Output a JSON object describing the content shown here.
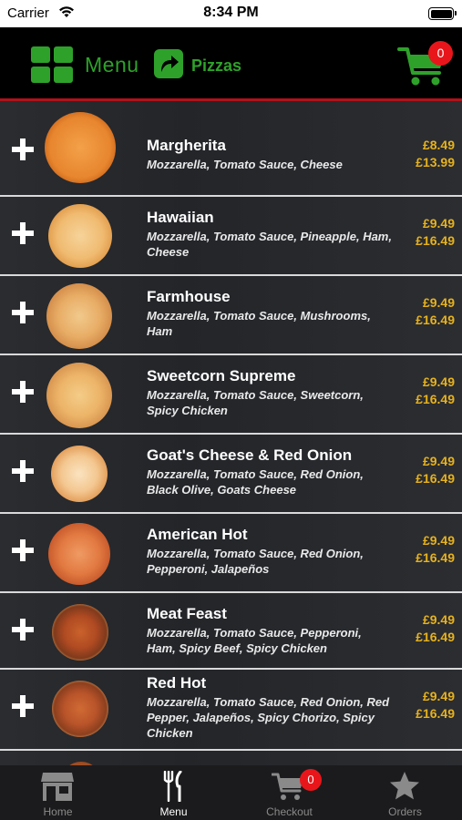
{
  "status_bar": {
    "carrier": "Carrier",
    "time": "8:34 PM"
  },
  "header": {
    "menu_label": "Menu",
    "section_label": "Pizzas",
    "cart_count": "0",
    "accent_color": "#2ea12b"
  },
  "items": [
    {
      "name": "Margherita",
      "description": "Mozzarella, Tomato Sauce, Cheese",
      "price_small": "£8.49",
      "price_large": "£13.99"
    },
    {
      "name": "Hawaiian",
      "description": "Mozzarella, Tomato Sauce, Pineapple, Ham, Cheese",
      "price_small": "£9.49",
      "price_large": "£16.49"
    },
    {
      "name": "Farmhouse",
      "description": "Mozzarella, Tomato Sauce, Mushrooms, Ham",
      "price_small": "£9.49",
      "price_large": "£16.49"
    },
    {
      "name": "Sweetcorn Supreme",
      "description": "Mozzarella, Tomato Sauce, Sweetcorn, Spicy Chicken",
      "price_small": "£9.49",
      "price_large": "£16.49"
    },
    {
      "name": "Goat's Cheese & Red Onion",
      "description": "Mozzarella, Tomato Sauce, Red Onion, Black Olive, Goats Cheese",
      "price_small": "£9.49",
      "price_large": "£16.49"
    },
    {
      "name": "American Hot",
      "description": "Mozzarella, Tomato Sauce, Red Onion, Pepperoni, Jalapeños",
      "price_small": "£9.49",
      "price_large": "£16.49"
    },
    {
      "name": "Meat Feast",
      "description": "Mozzarella, Tomato Sauce, Pepperoni, Ham, Spicy Beef, Spicy Chicken",
      "price_small": "£9.49",
      "price_large": "£16.49"
    },
    {
      "name": "Red Hot",
      "description": "Mozzarella, Tomato Sauce, Red Onion, Red Pepper, Jalapeños, Spicy Chorizo, Spicy Chicken",
      "price_small": "£9.49",
      "price_large": "£16.49"
    }
  ],
  "tabs": [
    {
      "label": "Home",
      "icon": "store-icon"
    },
    {
      "label": "Menu",
      "icon": "cutlery-icon",
      "active": true
    },
    {
      "label": "Checkout",
      "icon": "cart-icon",
      "badge": "0"
    },
    {
      "label": "Orders",
      "icon": "star-icon"
    }
  ]
}
